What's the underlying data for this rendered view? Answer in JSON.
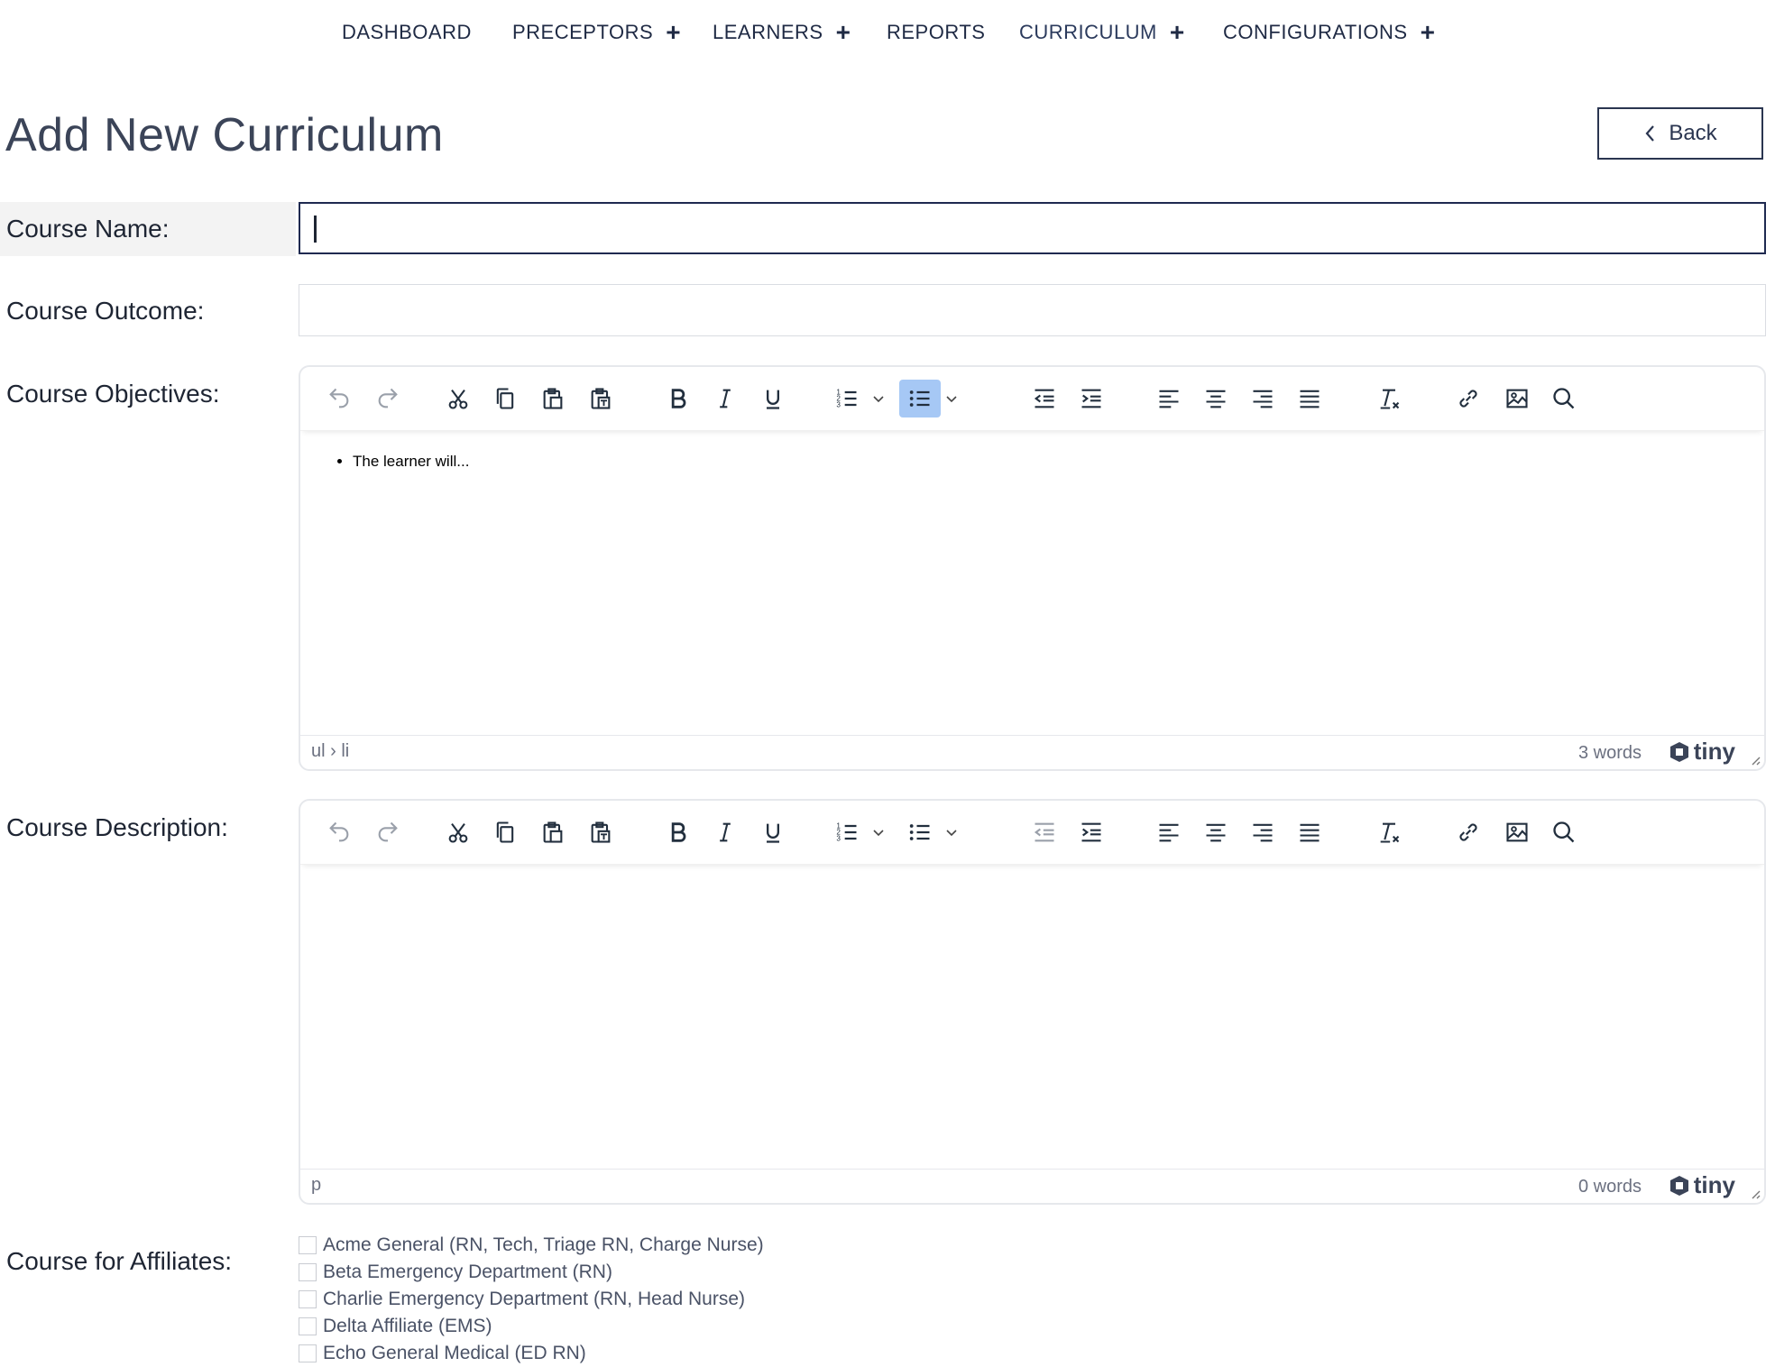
{
  "nav": {
    "items": [
      {
        "label": "DASHBOARD",
        "has_plus": false,
        "active": false
      },
      {
        "label": "PRECEPTORS",
        "has_plus": true,
        "active": false
      },
      {
        "label": "LEARNERS",
        "has_plus": true,
        "active": false
      },
      {
        "label": "REPORTS",
        "has_plus": false,
        "active": false
      },
      {
        "label": "CURRICULUM",
        "has_plus": true,
        "active": true
      },
      {
        "label": "CONFIGURATIONS",
        "has_plus": true,
        "active": false
      }
    ],
    "plus_glyph": "+"
  },
  "page": {
    "title": "Add New Curriculum",
    "back_label": "Back"
  },
  "form": {
    "course_name_label": "Course Name:",
    "course_name_value": "",
    "course_outcome_label": "Course Outcome:",
    "course_outcome_value": "",
    "course_objectives_label": "Course Objectives:",
    "course_description_label": "Course Description:",
    "course_affiliates_label": "Course for Affiliates:"
  },
  "editors": {
    "objectives": {
      "list_items": [
        "The learner will..."
      ],
      "path": "ul › li",
      "word_count": "3 words",
      "brand": "tiny"
    },
    "description": {
      "path": "p",
      "word_count": "0 words",
      "brand": "tiny"
    }
  },
  "affiliates": [
    "Acme General (RN, Tech, Triage RN, Charge Nurse)",
    "Beta Emergency Department (RN)",
    "Charlie Emergency Department (RN, Head Nurse)",
    "Delta Affiliate (EMS)",
    "Echo General Medical (ED RN)"
  ],
  "colors": {
    "nav_text": "#1f2a44",
    "title_text": "#3b4458",
    "focus_border": "#1f2a50",
    "toolbar_pressed": "#a6c8f5"
  }
}
